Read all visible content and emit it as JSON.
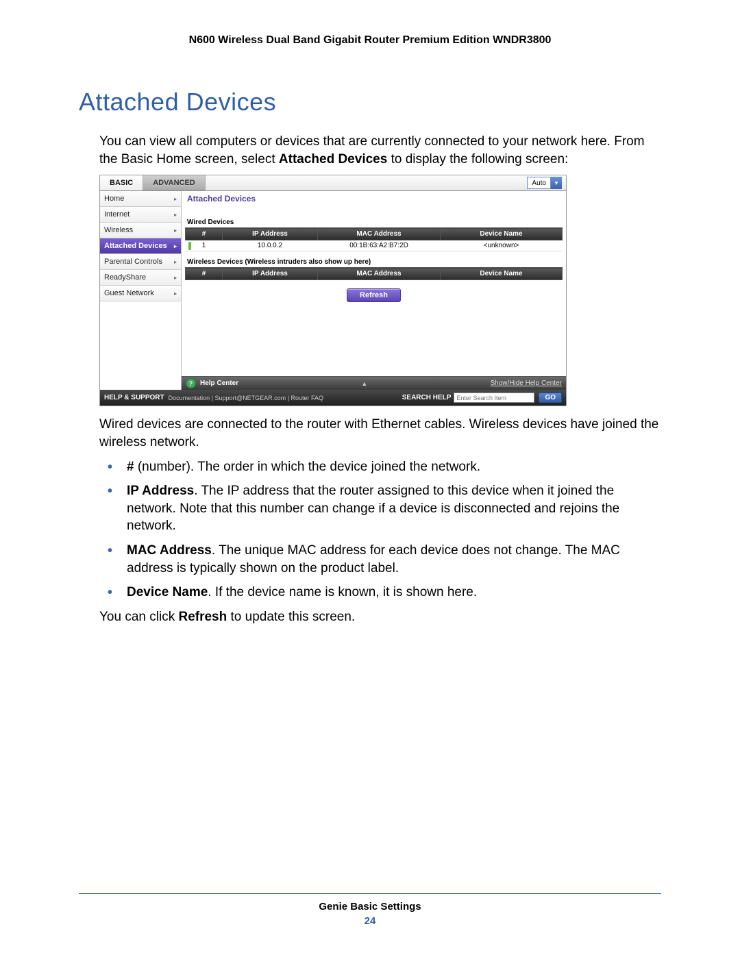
{
  "header": {
    "product_title": "N600 Wireless Dual Band Gigabit Router Premium Edition WNDR3800"
  },
  "section": {
    "title": "Attached Devices",
    "intro_a": "You can view all computers or devices that are currently connected to your network here. From the Basic Home screen, select ",
    "intro_bold": "Attached Devices",
    "intro_b": " to display the following screen:",
    "after_fig": "Wired devices are connected to the router with Ethernet cables. Wireless devices have joined the wireless network.",
    "bullets": [
      {
        "lead": "#",
        "rest": " (number). The order in which the device joined the network."
      },
      {
        "lead": "IP Address",
        "rest": ". The IP address that the router assigned to this device when it joined the network. Note that this number can change if a device is disconnected and rejoins the network."
      },
      {
        "lead": "MAC Address",
        "rest": ". The unique MAC address for each device does not change. The MAC address is typically shown on the product label."
      },
      {
        "lead": "Device Name",
        "rest": ". If the device name is known, it is shown here."
      }
    ],
    "closing_a": "You can click ",
    "closing_bold": "Refresh",
    "closing_b": " to update this screen."
  },
  "screenshot": {
    "tabs": {
      "basic": "BASIC",
      "advanced": "ADVANCED",
      "auto": "Auto"
    },
    "sidebar": [
      {
        "label": "Home",
        "active": false
      },
      {
        "label": "Internet",
        "active": false
      },
      {
        "label": "Wireless",
        "active": false
      },
      {
        "label": "Attached Devices",
        "active": true
      },
      {
        "label": "Parental Controls",
        "active": false
      },
      {
        "label": "ReadyShare",
        "active": false
      },
      {
        "label": "Guest Network",
        "active": false
      }
    ],
    "panel_title": "Attached Devices",
    "wired_heading": "Wired Devices",
    "wireless_heading": "Wireless Devices (Wireless intruders also show up here)",
    "columns": {
      "num": "#",
      "ip": "IP Address",
      "mac": "MAC Address",
      "name": "Device Name"
    },
    "wired_rows": [
      {
        "num": "1",
        "ip": "10.0.0.2",
        "mac": "00:1B:63:A2:B7:2D",
        "name": "<unknown>"
      }
    ],
    "wireless_rows": [],
    "refresh": "Refresh",
    "help_center": "Help Center",
    "show_hide": "Show/Hide Help Center",
    "support": {
      "label": "HELP & SUPPORT",
      "links": "Documentation | Support@NETGEAR.com | Router FAQ",
      "search_label": "SEARCH HELP",
      "search_placeholder": "Enter Search Item",
      "go": "GO"
    }
  },
  "footer": {
    "title": "Genie Basic Settings",
    "page": "24"
  }
}
